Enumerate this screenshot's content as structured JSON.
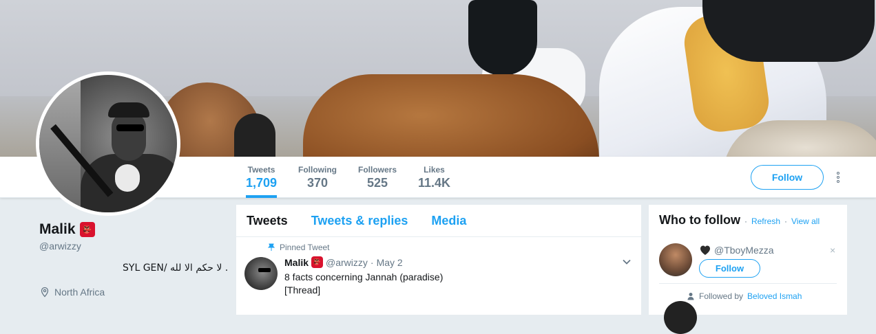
{
  "profile": {
    "name": "Malik",
    "name_emoji": "👺",
    "handle": "@arwizzy",
    "bio": "SYL GEN/ لا حكم الا لله .",
    "location": "North Africa"
  },
  "stats": [
    {
      "label": "Tweets",
      "value": "1,709",
      "active": true
    },
    {
      "label": "Following",
      "value": "370",
      "active": false
    },
    {
      "label": "Followers",
      "value": "525",
      "active": false
    },
    {
      "label": "Likes",
      "value": "11.4K",
      "active": false
    }
  ],
  "actions": {
    "follow_label": "Follow"
  },
  "timeline": {
    "tabs": [
      "Tweets",
      "Tweets & replies",
      "Media"
    ],
    "active_tab": "Tweets",
    "pinned_label": "Pinned Tweet",
    "tweet": {
      "name": "Malik",
      "handle": "@arwizzy",
      "separator": "·",
      "date": "May 2",
      "line1": "8 facts concerning Jannah (paradise)",
      "line2": "[Thread]"
    }
  },
  "who_to_follow": {
    "title": "Who to follow",
    "separator": "·",
    "refresh_label": "Refresh",
    "view_all_label": "View all",
    "suggestion": {
      "handle": "@TboyMezza",
      "follow_label": "Follow",
      "close": "×"
    },
    "followed_by_prefix": "Followed by",
    "followed_by_name": "Beloved Ismah"
  },
  "colors": {
    "accent": "#1da1f2",
    "muted": "#657786",
    "background": "#e6ecf0"
  }
}
